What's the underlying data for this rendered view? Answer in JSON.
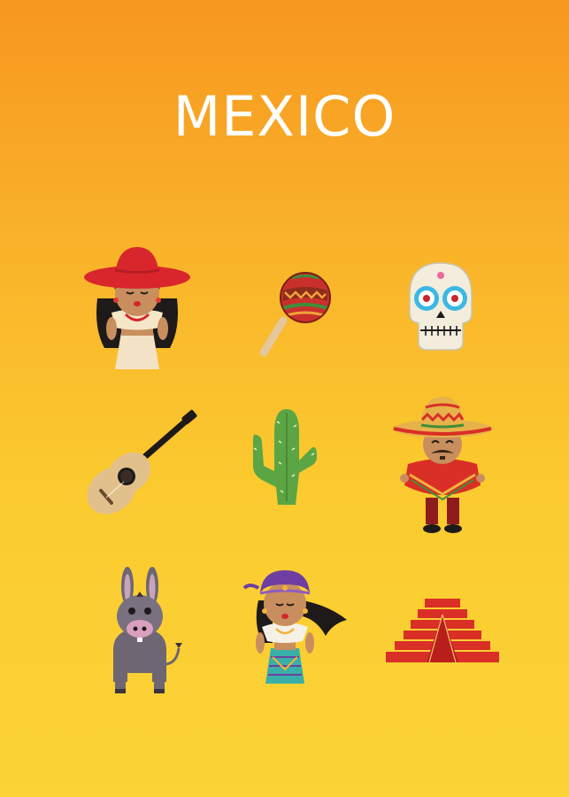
{
  "poster": {
    "title": "MEXICO",
    "background_colors": [
      "#F7971F",
      "#FBCB2F",
      "#FBD337"
    ],
    "icons": [
      "woman-sombrero-icon",
      "maraca-icon",
      "sugar-skull-icon",
      "guitar-icon",
      "cactus-icon",
      "man-sombrero-poncho-icon",
      "donkey-icon",
      "dancer-woman-icon",
      "pyramid-icon"
    ]
  }
}
